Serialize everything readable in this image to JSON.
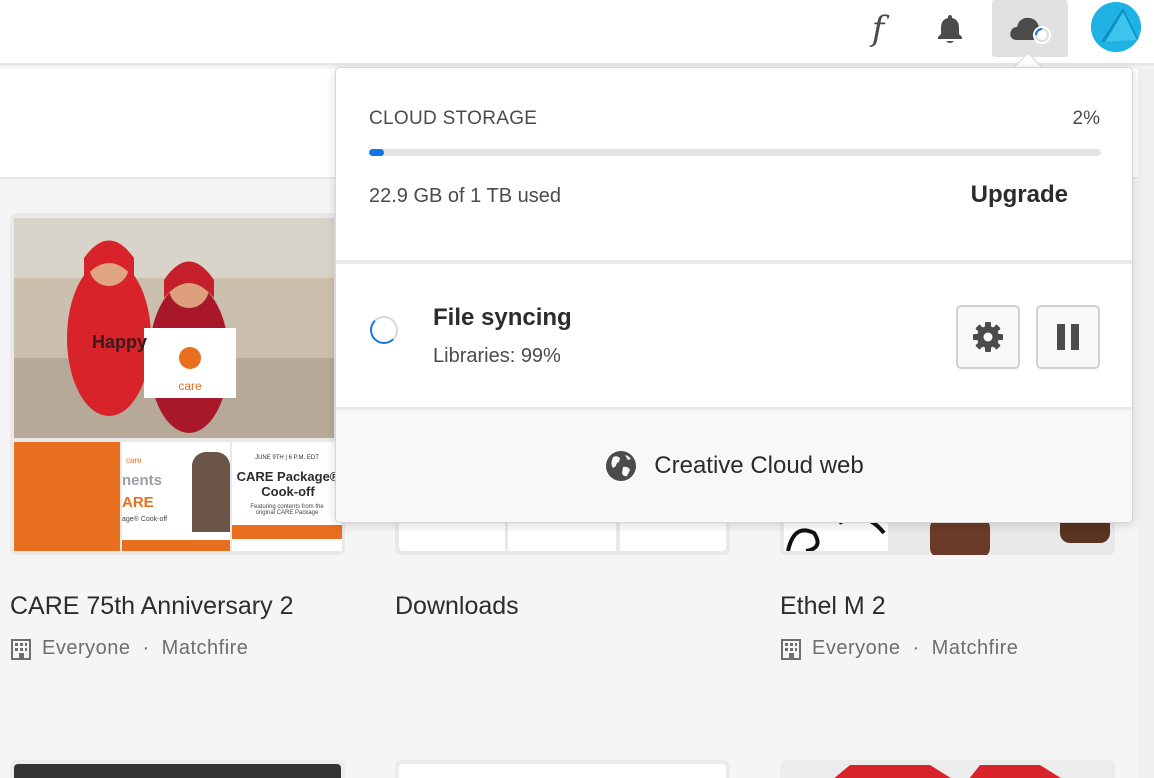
{
  "topbar": {
    "font_icon": "f",
    "icons": [
      "fonts-icon",
      "bell-icon",
      "cloud-sync-icon",
      "avatar"
    ]
  },
  "cards": [
    {
      "title": "CARE 75th Anniversary 2",
      "meta_visibility": "Everyone",
      "meta_org": "Matchfire",
      "thumb": {
        "logo": "care",
        "tile_text_1": "nents",
        "tile_text_2": "ARE",
        "tile_text_3": "age® Cook-off",
        "promo_date": "JUNE 9TH | 6 P.M. EDT",
        "promo_title": "CARE Package® Cook-off",
        "promo_sub": "Featuring contents from the original CARE Package"
      }
    },
    {
      "title": "Downloads"
    },
    {
      "title": "Ethel M 2",
      "meta_visibility": "Everyone",
      "meta_org": "Matchfire"
    }
  ],
  "popover": {
    "storage_label": "CLOUD STORAGE",
    "storage_percent": "2%",
    "storage_fraction": 0.02,
    "storage_used": "22.9 GB of 1 TB used",
    "upgrade_label": "Upgrade",
    "sync_title": "File syncing",
    "sync_sub": "Libraries: 99%",
    "web_label": "Creative Cloud web"
  },
  "colors": {
    "accent": "#1473e6",
    "avatar": "#1fb3e5",
    "care_orange": "#e76f1e"
  }
}
